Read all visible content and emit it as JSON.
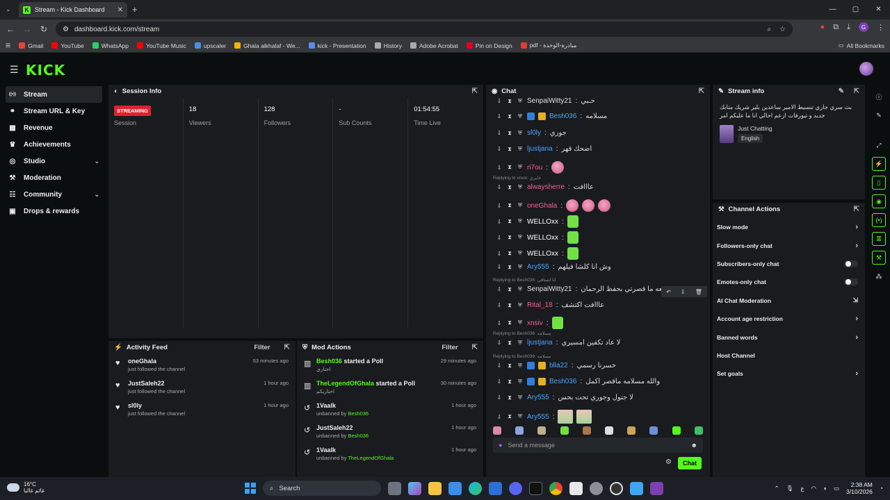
{
  "browser": {
    "tab_title": "Stream - Kick Dashboard",
    "tab_icon_letter": "K",
    "url": "dashboard.kick.com/stream",
    "profile_letter": "G",
    "bookmarks": [
      {
        "label": "Gmail",
        "color": "#ea4335"
      },
      {
        "label": "YouTube",
        "color": "#ff0000"
      },
      {
        "label": "WhatsApp",
        "color": "#25d366"
      },
      {
        "label": "YouTube Music",
        "color": "#ff0000"
      },
      {
        "label": "upscaler",
        "color": "#4a90e2"
      },
      {
        "label": "Ghala alkhalaf - We...",
        "color": "#f4b400"
      },
      {
        "label": "kick - Presentation",
        "color": "#5b8def"
      },
      {
        "label": "History",
        "color": "#aaaaaa"
      },
      {
        "label": "Adobe Acrobat",
        "color": "#aaaaaa"
      },
      {
        "label": "Pin on Design",
        "color": "#e60023"
      },
      {
        "label": "pdf - مبادرة-الوحدة",
        "color": "#e03c31"
      }
    ],
    "all_bookmarks": "All Bookmarks"
  },
  "header": {
    "logo": "KICK"
  },
  "sidebar": {
    "items": [
      {
        "label": "Stream",
        "icon": "stream-icon",
        "glyph": "((•))"
      },
      {
        "label": "Stream URL & Key",
        "icon": "link-icon",
        "glyph": "⚭"
      },
      {
        "label": "Revenue",
        "icon": "chart-icon",
        "glyph": "▦"
      },
      {
        "label": "Achievements",
        "icon": "trophy-icon",
        "glyph": "♛"
      },
      {
        "label": "Studio",
        "icon": "layers-icon",
        "glyph": "◎"
      },
      {
        "label": "Moderation",
        "icon": "hammer-icon",
        "glyph": "⚒"
      },
      {
        "label": "Community",
        "icon": "people-icon",
        "glyph": "☷"
      },
      {
        "label": "Drops & rewards",
        "icon": "gift-icon",
        "glyph": "▣"
      }
    ]
  },
  "session": {
    "title": "Session Info",
    "status": "STREAMING",
    "session_label": "Session",
    "viewers": "18",
    "viewers_label": "Viewers",
    "followers": "128",
    "followers_label": "Followers",
    "subs": "-",
    "subs_label": "Sub Counts",
    "time": "01:54:55",
    "time_label": "Time Live"
  },
  "activity": {
    "title": "Activity Feed",
    "filter": "Filter",
    "items": [
      {
        "name": "oneGhala",
        "sub": "just followed the channel",
        "time": "53 minutes ago"
      },
      {
        "name": "JustSaleh22",
        "sub": "just followed the channel",
        "time": "1 hour ago"
      },
      {
        "name": "sl0ly",
        "sub": "just followed the channel",
        "time": "1 hour ago"
      }
    ]
  },
  "mod": {
    "title": "Mod Actions",
    "filter": "Filter",
    "items": [
      {
        "name": "Besh036",
        "action": "started a Poll",
        "sub": "اختاري",
        "time": "29 minutes ago"
      },
      {
        "name": "TheLegendOfGhala",
        "action": "started a Poll",
        "sub": "اختاريكم",
        "time": "30 minutes ago"
      },
      {
        "name": "1Vaalk",
        "action": "",
        "sub_prefix": "unbanned by",
        "by": "Besh036",
        "time": "1 hour ago"
      },
      {
        "name": "JustSaleh22",
        "action": "",
        "sub_prefix": "unbanned by",
        "by": "Besh036",
        "time": "1 hour ago"
      },
      {
        "name": "1Vaalk",
        "action": "",
        "sub_prefix": "unbanned by",
        "by": "TheLegendOfGhala",
        "time": "1 hour ago"
      }
    ]
  },
  "chat": {
    "title": "Chat",
    "messages": [
      {
        "user": "SenpaiWitty21",
        "color": "#e0e0e0",
        "text": "حـبي"
      },
      {
        "user": "Besh036",
        "color": "#4aa3ff",
        "text": "مسلامه"
      },
      {
        "user": "sl0ly",
        "color": "#4aa3ff",
        "text": "جوري"
      },
      {
        "user": "ljustjana",
        "color": "#4aa3ff",
        "text": "اضحك قهر"
      },
      {
        "user": "ri7ou",
        "color": "#ff5d8f",
        "text": ""
      },
      {
        "user": "alwaysherre",
        "color": "#ff5d8f",
        "text": "عااافت",
        "reply": "Replying to xnsiv: خايري"
      },
      {
        "user": "oneGhala",
        "color": "#ff5d8f",
        "text": ""
      },
      {
        "user": "WELLOxx",
        "color": "#ffffff",
        "text": ""
      },
      {
        "user": "WELLOxx",
        "color": "#ffffff",
        "text": ""
      },
      {
        "user": "WELLOxx",
        "color": "#ffffff",
        "text": ""
      },
      {
        "user": "Ary555",
        "color": "#4aa3ff",
        "text": "وش انا كلشا فيلهم"
      },
      {
        "user": "SenpaiWitty21",
        "color": "#e0e0e0",
        "text": "موقعه ما قصرتي بحفظ الرحمان",
        "reply": "Replying to Besh036: انا اشتاقي"
      },
      {
        "user": "Rital_18",
        "color": "#ff5d8f",
        "text": "عااافت اكتشف"
      },
      {
        "user": "xnsiv",
        "color": "#ff5d8f",
        "text": ""
      },
      {
        "user": "ljustjana",
        "color": "#4aa3ff",
        "text": "لا عاد تكفين امسيري",
        "reply": "Replying to Besh036: مسلامه"
      },
      {
        "user": "blla22",
        "color": "#4aa3ff",
        "text": "خسرنا رسمي",
        "reply": "Replying to Besh036: مسلامه"
      },
      {
        "user": "Besh036",
        "color": "#4aa3ff",
        "text": "والله مسلامه ماقصر اكمل"
      },
      {
        "user": "Ary555",
        "color": "#4aa3ff",
        "text": "لا جتول وجوري تحت بحس"
      },
      {
        "user": "Ary555",
        "color": "#4aa3ff",
        "text": ""
      }
    ],
    "placeholder": "Send a message",
    "send_label": "Chat"
  },
  "stream_info": {
    "title": "Stream info",
    "text": "بث سري جاري تنسيط الامير ساعدين بليز شريك متابك جديد و تيورفات ازعم احالي انا ما عليكم امر",
    "category": "Just Chatting",
    "language": "English"
  },
  "channel_actions": {
    "title": "Channel Actions",
    "items": [
      {
        "label": "Slow mode",
        "kind": "arrow"
      },
      {
        "label": "Followers-only chat",
        "kind": "arrow"
      },
      {
        "label": "Subscribers-only chat",
        "kind": "toggle"
      },
      {
        "label": "Emotes-only chat",
        "kind": "toggle"
      },
      {
        "label": "AI Chat Moderation",
        "kind": "ext"
      },
      {
        "label": "Account age restriction",
        "kind": "arrow"
      },
      {
        "label": "Banned words",
        "kind": "arrow"
      },
      {
        "label": "Host Channel",
        "kind": "none"
      },
      {
        "label": "Set goals",
        "kind": "arrow"
      }
    ]
  },
  "taskbar": {
    "temp": "16°C",
    "weather": "غائم غالبا",
    "search": "Search",
    "lang": "ع",
    "time": "2:38 AM",
    "date": "3/10/2026"
  },
  "colors": {
    "accent": "#53fc18",
    "live": "#e0222e"
  }
}
